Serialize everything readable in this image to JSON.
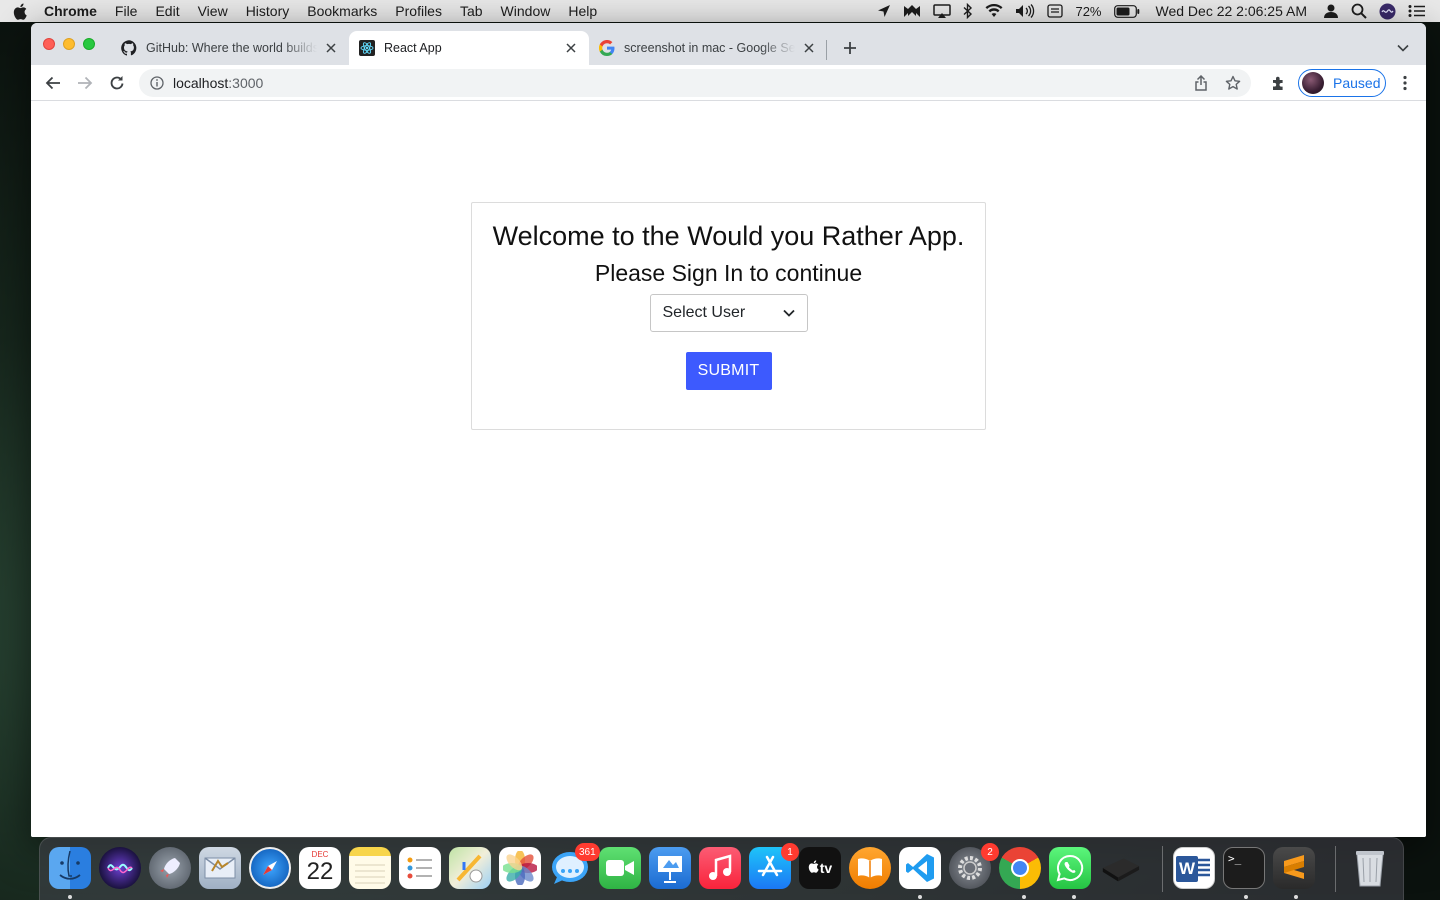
{
  "menubar": {
    "app_name": "Chrome",
    "menus": [
      "File",
      "Edit",
      "View",
      "History",
      "Bookmarks",
      "Profiles",
      "Tab",
      "Window",
      "Help"
    ],
    "battery": "72%",
    "clock": "Wed Dec 22  2:06:25 AM"
  },
  "browser": {
    "tabs": [
      {
        "title": "GitHub: Where the world builds software",
        "favicon": "github-icon",
        "active": false
      },
      {
        "title": "React App",
        "favicon": "react-icon",
        "active": true
      },
      {
        "title": "screenshot in mac - Google Search",
        "favicon": "google-icon",
        "active": false
      }
    ],
    "url_host": "localhost",
    "url_port": ":3000",
    "profile_label": "Paused"
  },
  "page": {
    "title": "Welcome to the Would you Rather App.",
    "subtitle": "Please Sign In to continue",
    "select_value": "Select User",
    "submit_label": "SUBMIT"
  },
  "dock": {
    "calendar_month": "DEC",
    "calendar_day": "22",
    "messages_badge": "361",
    "appstore_badge": "1",
    "settings_badge": "2",
    "appletv_label": "tv",
    "word_letter": "W",
    "terminal_prompt": ">_",
    "colors": {
      "accent": "#3d5afe"
    }
  }
}
